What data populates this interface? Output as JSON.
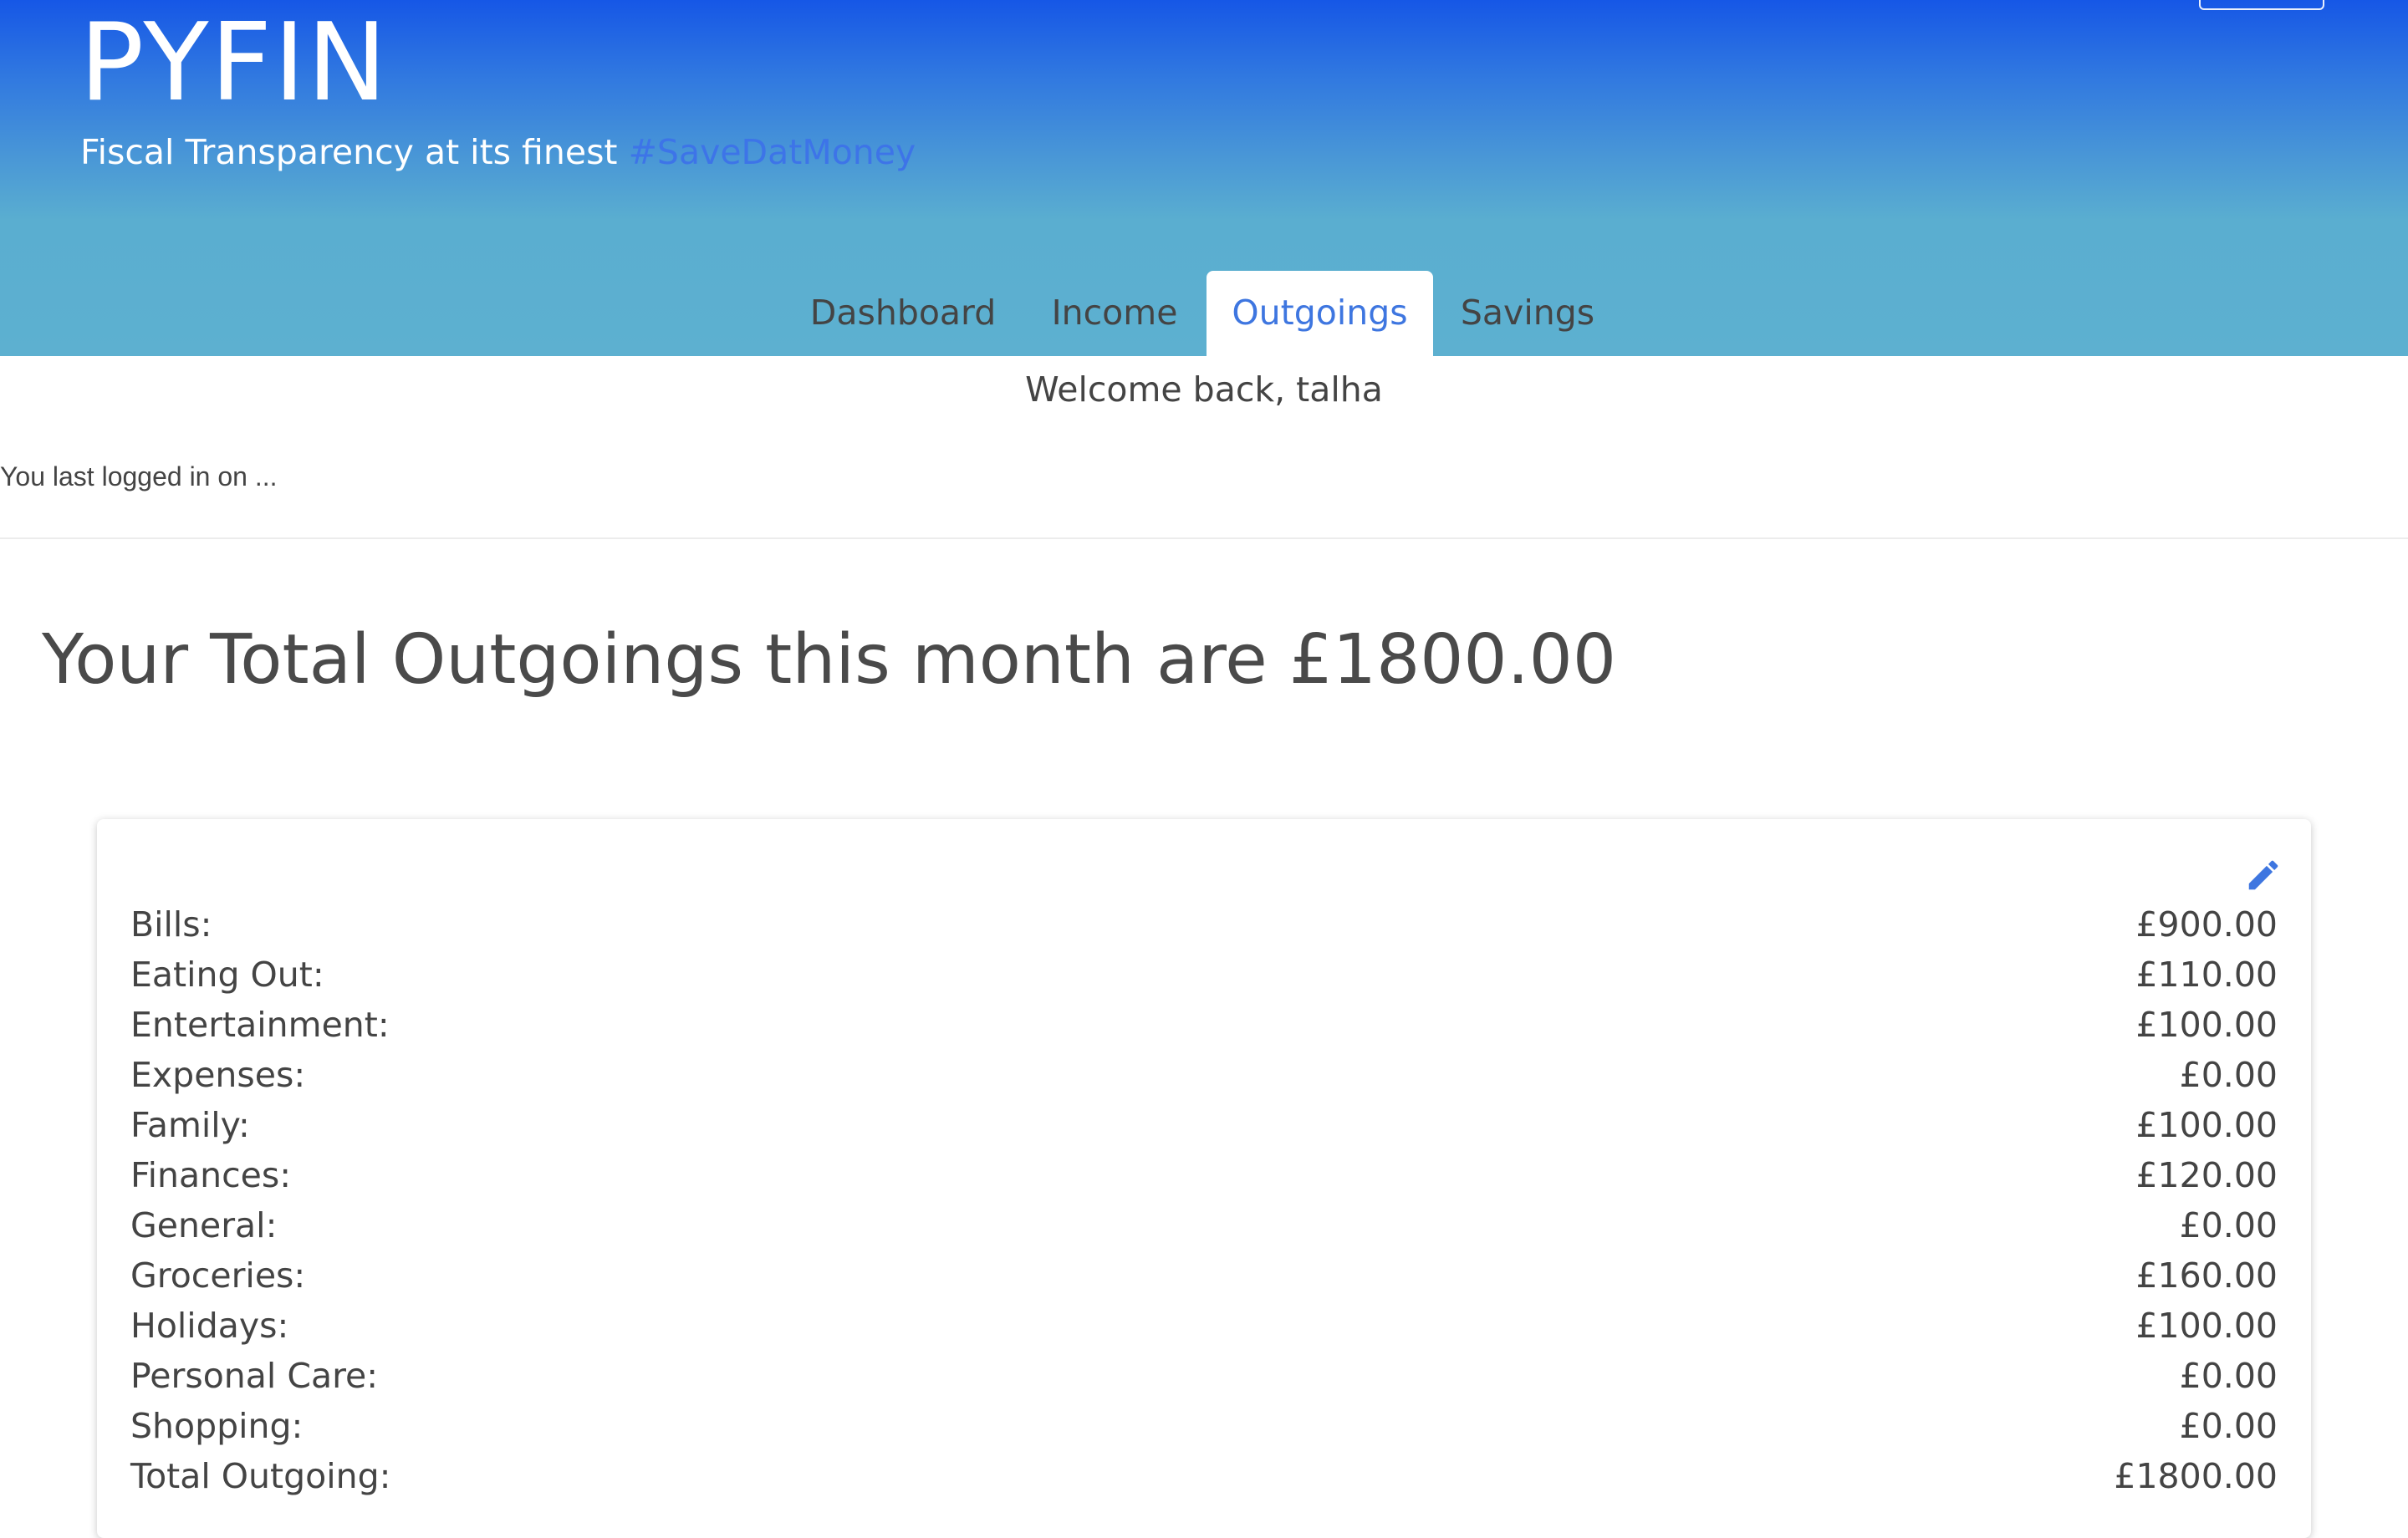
{
  "header": {
    "brand": "PYFIN",
    "tagline": "Fiscal Transparency at its finest",
    "hashtag": "#SaveDatMoney",
    "gradient_top": "#1657e6",
    "gradient_bottom": "#5db0d0"
  },
  "tabs": [
    {
      "label": "Dashboard",
      "active": false
    },
    {
      "label": "Income",
      "active": false
    },
    {
      "label": "Outgoings",
      "active": true
    },
    {
      "label": "Savings",
      "active": false
    }
  ],
  "welcome": "Welcome back, talha",
  "last_login": "You last logged in on ...",
  "total_heading": "Your Total Outgoings this month are £1800.00",
  "outgoings": {
    "edit_icon": "pencil-icon",
    "accent": "#3e76e0",
    "rows": [
      {
        "label": "Bills:",
        "value": "£900.00"
      },
      {
        "label": "Eating Out:",
        "value": "£110.00"
      },
      {
        "label": "Entertainment:",
        "value": "£100.00"
      },
      {
        "label": "Expenses:",
        "value": "£0.00"
      },
      {
        "label": "Family:",
        "value": "£100.00"
      },
      {
        "label": "Finances:",
        "value": "£120.00"
      },
      {
        "label": "General:",
        "value": "£0.00"
      },
      {
        "label": "Groceries:",
        "value": "£160.00"
      },
      {
        "label": "Holidays:",
        "value": "£100.00"
      },
      {
        "label": "Personal Care:",
        "value": "£0.00"
      },
      {
        "label": "Shopping:",
        "value": "£0.00"
      },
      {
        "label": "Total Outgoing:",
        "value": "£1800.00"
      }
    ]
  }
}
